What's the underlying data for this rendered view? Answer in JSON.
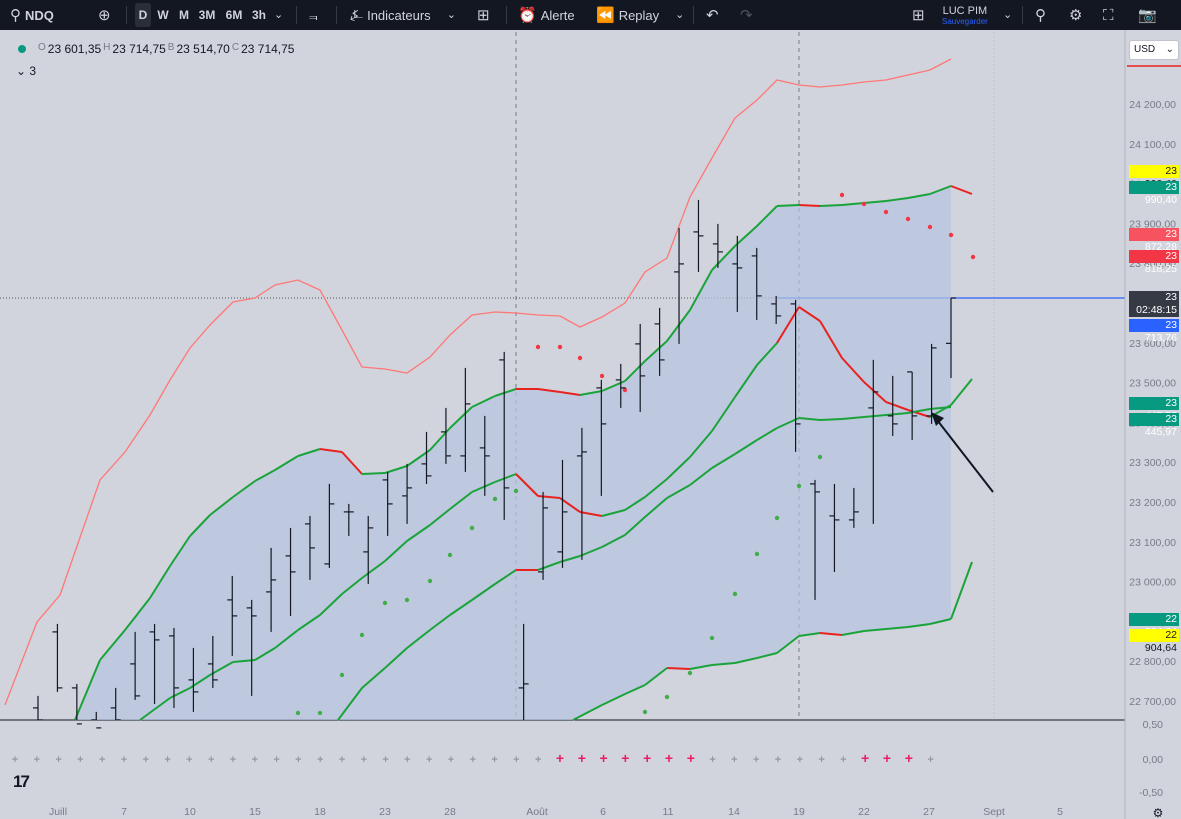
{
  "toolbar": {
    "symbol": "NDQ",
    "timeframes": [
      "D",
      "W",
      "M",
      "3M",
      "6M",
      "3h"
    ],
    "active_timeframe": "D",
    "indicators_label": "Indicateurs",
    "alert_label": "Alerte",
    "replay_label": "Replay",
    "layout_name": "LUC PIM",
    "layout_status": "Sauvegarder"
  },
  "legend": {
    "open_label": "O",
    "open": "23 601,35",
    "high_label": "H",
    "high": "23 714,75",
    "low_label": "B",
    "low": "23 514,70",
    "close_label": "C",
    "close": "23 714,75",
    "collapsed_count": "3"
  },
  "currency": "USD",
  "price_axis": {
    "ticks": [
      "24 200,00",
      "24 100,00",
      "24 000,00",
      "23 900,00",
      "23 800,00",
      "23 700,00",
      "23 600,00",
      "23 500,00",
      "23 400,00",
      "23 300,00",
      "23 200,00",
      "23 100,00",
      "23 000,00",
      "22 900,00",
      "22 800,00",
      "22 700,00"
    ],
    "tags": [
      {
        "label": "23 990,40",
        "bg": "#ffff00",
        "fg": "#131722"
      },
      {
        "label": "23 990,40",
        "bg": "#089981",
        "fg": "#ffffff"
      },
      {
        "label": "23 872,28",
        "bg": "#f7525f",
        "fg": "#ffffff"
      },
      {
        "label": "23 818,25",
        "bg": "#f23645",
        "fg": "#ffffff"
      },
      {
        "label": "23 714,75",
        "bg": "#363a45",
        "fg": "#ffffff"
      },
      {
        "label": "02:48:15",
        "bg": "#363a45",
        "fg": "#ffffff"
      },
      {
        "label": "23 713,76",
        "bg": "#2962ff",
        "fg": "#ffffff"
      },
      {
        "label": "23 447,52",
        "bg": "#089981",
        "fg": "#ffffff"
      },
      {
        "label": "23 445,97",
        "bg": "#089981",
        "fg": "#ffffff"
      },
      {
        "label": "22 904,64",
        "bg": "#089981",
        "fg": "#ffffff"
      },
      {
        "label": "22 904,64",
        "bg": "#ffff00",
        "fg": "#131722"
      }
    ]
  },
  "osc_axis": {
    "ticks": [
      "0,50",
      "0,00",
      "-0,50"
    ]
  },
  "time_axis": {
    "labels": [
      "Juill",
      "7",
      "10",
      "15",
      "18",
      "23",
      "28",
      "Août",
      "6",
      "11",
      "14",
      "19",
      "22",
      "27",
      "Sept",
      "5"
    ]
  },
  "colors": {
    "green": "#1aa33a",
    "red": "#e8221f",
    "light_red": "#f77",
    "fill": "#b7c5e0",
    "bar": "#131722",
    "current_line": "#2962ff"
  },
  "chart_data": {
    "type": "candlestick",
    "ylim": [
      22600,
      24300
    ],
    "ohlc_bars": [
      {
        "date": "Juill 1",
        "o": 22690,
        "h": 22720,
        "l": 22600,
        "c": 22660
      },
      {
        "date": "Juill 2",
        "o": 22880,
        "h": 22900,
        "l": 22730,
        "c": 22740
      },
      {
        "date": "Juill 3",
        "o": 22740,
        "h": 22750,
        "l": 22600,
        "c": 22650
      },
      {
        "date": "Juill 7",
        "o": 22660,
        "h": 22680,
        "l": 22610,
        "c": 22640
      },
      {
        "date": "Juill 8",
        "o": 22690,
        "h": 22740,
        "l": 22620,
        "c": 22660
      },
      {
        "date": "Juill 9",
        "o": 22800,
        "h": 22880,
        "l": 22710,
        "c": 22720
      },
      {
        "date": "Juill 10",
        "o": 22880,
        "h": 22900,
        "l": 22700,
        "c": 22860
      },
      {
        "date": "Juill 11",
        "o": 22870,
        "h": 22890,
        "l": 22690,
        "c": 22740
      },
      {
        "date": "Juill 14",
        "o": 22760,
        "h": 22840,
        "l": 22680,
        "c": 22730
      },
      {
        "date": "Juill 15",
        "o": 22800,
        "h": 22870,
        "l": 22740,
        "c": 22760
      },
      {
        "date": "Juill 16",
        "o": 22960,
        "h": 23020,
        "l": 22820,
        "c": 22920
      },
      {
        "date": "Juill 17",
        "o": 22940,
        "h": 22960,
        "l": 22720,
        "c": 22920
      },
      {
        "date": "Juill 18",
        "o": 22980,
        "h": 23090,
        "l": 22880,
        "c": 23010
      },
      {
        "date": "Juill 21",
        "o": 23070,
        "h": 23140,
        "l": 22920,
        "c": 23030
      },
      {
        "date": "Juill 22",
        "o": 23150,
        "h": 23170,
        "l": 23010,
        "c": 23090
      },
      {
        "date": "Juill 23",
        "o": 23050,
        "h": 23250,
        "l": 23040,
        "c": 23200
      },
      {
        "date": "Juill 24",
        "o": 23180,
        "h": 23200,
        "l": 23120,
        "c": 23180
      },
      {
        "date": "Juill 25",
        "o": 23080,
        "h": 23170,
        "l": 23000,
        "c": 23140
      },
      {
        "date": "Juill 28",
        "o": 23260,
        "h": 23280,
        "l": 23120,
        "c": 23200
      },
      {
        "date": "Juill 29",
        "o": 23220,
        "h": 23300,
        "l": 23150,
        "c": 23240
      },
      {
        "date": "Juill 30",
        "o": 23300,
        "h": 23380,
        "l": 23250,
        "c": 23270
      },
      {
        "date": "Juill 31",
        "o": 23380,
        "h": 23440,
        "l": 23300,
        "c": 23320
      },
      {
        "date": "Août 1",
        "o": 23320,
        "h": 23540,
        "l": 23280,
        "c": 23450
      },
      {
        "date": "Août 4",
        "o": 23340,
        "h": 23420,
        "l": 23220,
        "c": 23320
      },
      {
        "date": "Août 5",
        "o": 23560,
        "h": 23580,
        "l": 23160,
        "c": 23240
      },
      {
        "date": "Août 6",
        "o": 22740,
        "h": 22900,
        "l": 22600,
        "c": 22750
      },
      {
        "date": "Août 7",
        "o": 23030,
        "h": 23230,
        "l": 23010,
        "c": 23190
      },
      {
        "date": "Août 8",
        "o": 23080,
        "h": 23310,
        "l": 23040,
        "c": 23180
      },
      {
        "date": "Août 11",
        "o": 23320,
        "h": 23390,
        "l": 23060,
        "c": 23330
      },
      {
        "date": "Août 12",
        "o": 23490,
        "h": 23510,
        "l": 23220,
        "c": 23400
      },
      {
        "date": "Août 13",
        "o": 23510,
        "h": 23550,
        "l": 23440,
        "c": 23490
      },
      {
        "date": "Août 14",
        "o": 23600,
        "h": 23650,
        "l": 23430,
        "c": 23520
      },
      {
        "date": "Août 15",
        "o": 23650,
        "h": 23690,
        "l": 23520,
        "c": 23560
      },
      {
        "date": "Août 18",
        "o": 23780,
        "h": 23890,
        "l": 23600,
        "c": 23800
      },
      {
        "date": "Août 19",
        "o": 23880,
        "h": 23960,
        "l": 23780,
        "c": 23870
      },
      {
        "date": "Août 20",
        "o": 23850,
        "h": 23900,
        "l": 23790,
        "c": 23830
      },
      {
        "date": "Août 21",
        "o": 23800,
        "h": 23870,
        "l": 23680,
        "c": 23790
      },
      {
        "date": "Août 22",
        "o": 23820,
        "h": 23840,
        "l": 23660,
        "c": 23720
      },
      {
        "date": "Août 25",
        "o": 23700,
        "h": 23720,
        "l": 23650,
        "c": 23670
      },
      {
        "date": "Août 26",
        "o": 23700,
        "h": 23710,
        "l": 23330,
        "c": 23400
      },
      {
        "date": "Août 27",
        "o": 23250,
        "h": 23260,
        "l": 22960,
        "c": 23230
      },
      {
        "date": "Août 28",
        "o": 23170,
        "h": 23250,
        "l": 23030,
        "c": 23160
      },
      {
        "date": "Août 29",
        "o": 23160,
        "h": 23240,
        "l": 23140,
        "c": 23180
      },
      {
        "date": "Août 30",
        "o": 23440,
        "h": 23560,
        "l": 23150,
        "c": 23480
      },
      {
        "date": "Août 31",
        "o": 23420,
        "h": 23520,
        "l": 23370,
        "c": 23400
      },
      {
        "date": "Sept 1",
        "o": 23530,
        "h": 23530,
        "l": 23360,
        "c": 23420
      },
      {
        "date": "Sept 2",
        "o": 23420,
        "h": 23600,
        "l": 23400,
        "c": 23590
      },
      {
        "date": "Sept 3",
        "o": 23601.35,
        "h": 23714.75,
        "l": 23514.7,
        "c": 23714.75
      }
    ]
  }
}
